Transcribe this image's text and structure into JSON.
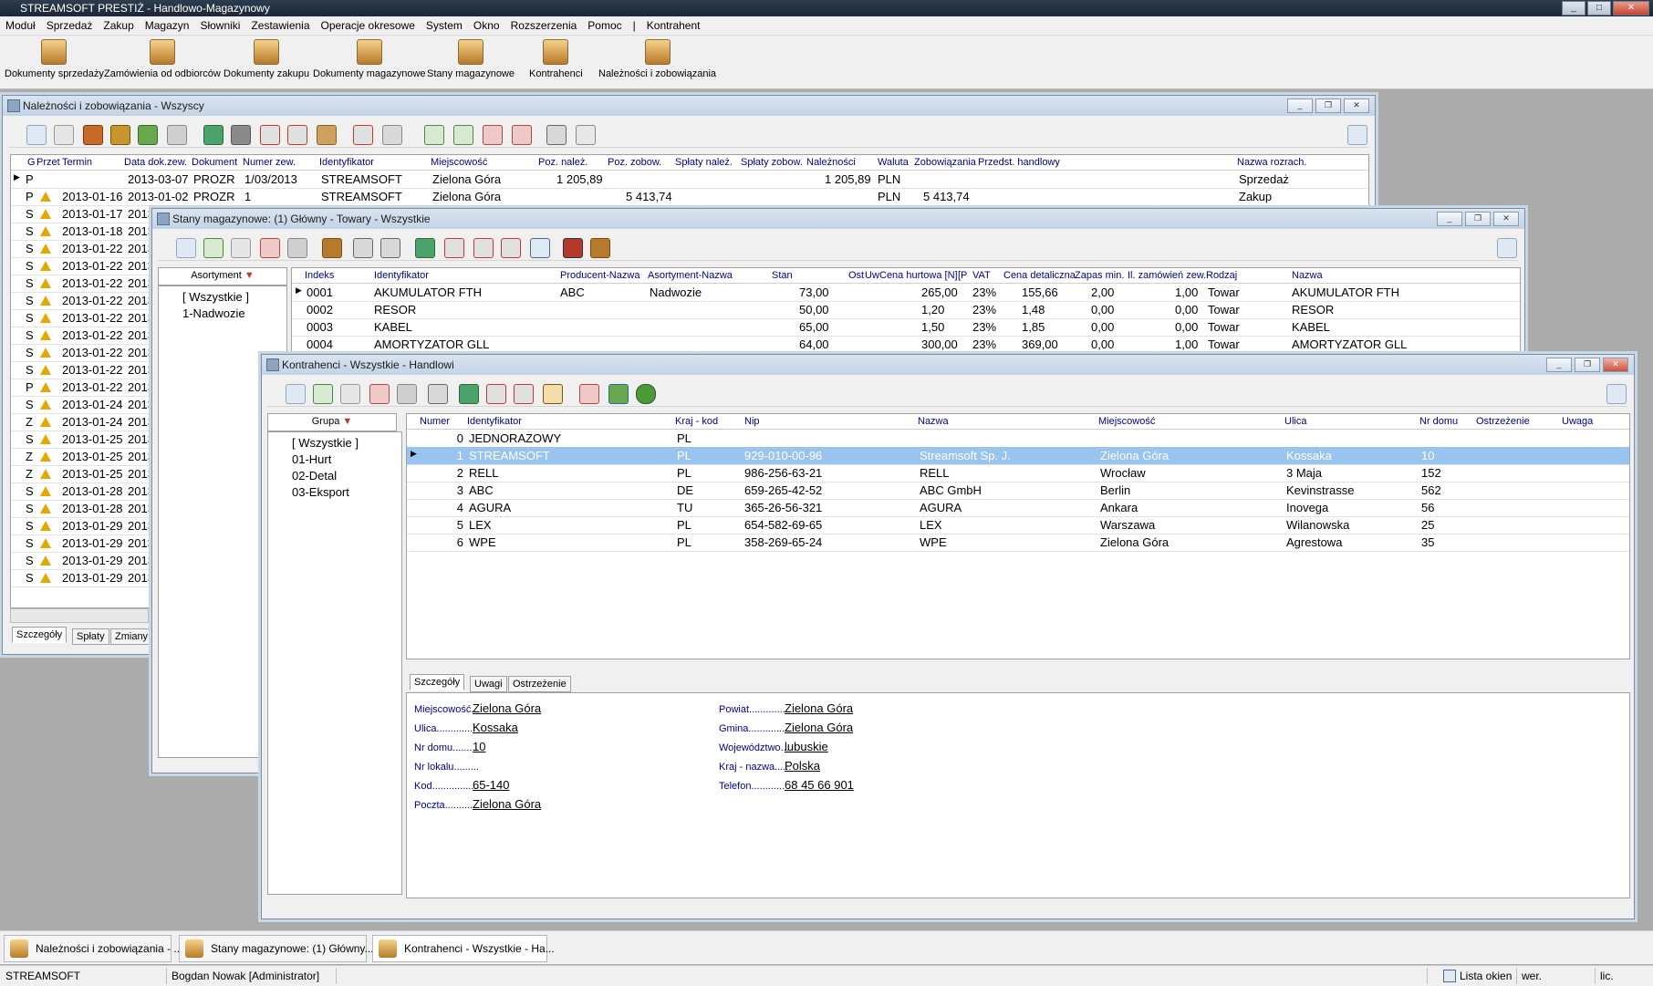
{
  "app": {
    "title": "STREAMSOFT PRESTIŻ - Handlowo-Magazynowy"
  },
  "menu": [
    "Moduł",
    "Sprzedaż",
    "Zakup",
    "Magazyn",
    "Słowniki",
    "Zestawienia",
    "Operacje okresowe",
    "System",
    "Okno",
    "Rozszerzenia",
    "Pomoc",
    "|",
    "Kontrahent"
  ],
  "big_toolbar": [
    "Dokumenty sprzedaży",
    "Zamówienia od odbiorców",
    "Dokumenty zakupu",
    "Dokumenty magazynowe",
    "Stany magazynowe",
    "Kontrahenci",
    "Należności i zobowiązania"
  ],
  "win1": {
    "title": "Należności i zobowiązania - Wszyscy",
    "columns": [
      "G",
      "Przet",
      "Termin",
      "Data dok.zew.",
      "Dokument",
      "Numer zew.",
      "Identyfikator",
      "Miejscowość",
      "Poz. należ.",
      "Poz. zobow.",
      "Spłaty należ.",
      "Spłaty zobow.",
      "Należności",
      "Waluta",
      "Zobowiązania",
      "Przedst. handlowy",
      "Nazwa rozrach."
    ],
    "rows": [
      {
        "g": "P",
        "termin": "",
        "data": "2013-03-07",
        "dok": "PROZR",
        "nr": "1/03/2013",
        "id": "STREAMSOFT",
        "miejsc": "Zielona Góra",
        "poznal": "1 205,89",
        "pozzob": "",
        "nal": "1 205,89",
        "waluta": "PLN",
        "zob": "",
        "nazwa": "Sprzedaż"
      },
      {
        "g": "P",
        "termin": "2013-01-16",
        "data": "2013-01-02",
        "dok": "PROZR",
        "nr": "1",
        "id": "STREAMSOFT",
        "miejsc": "Zielona Góra",
        "poznal": "",
        "pozzob": "5 413,74",
        "nal": "",
        "waluta": "PLN",
        "zob": "5 413,74",
        "nazwa": "Zakup"
      },
      {
        "g": "S",
        "termin": "2013-01-17",
        "data": "2013"
      },
      {
        "g": "S",
        "termin": "2013-01-18",
        "data": "2013"
      },
      {
        "g": "S",
        "termin": "2013-01-22",
        "data": "2013"
      },
      {
        "g": "S",
        "termin": "2013-01-22",
        "data": "2013"
      },
      {
        "g": "S",
        "termin": "2013-01-22",
        "data": "2013"
      },
      {
        "g": "S",
        "termin": "2013-01-22",
        "data": "2013"
      },
      {
        "g": "S",
        "termin": "2013-01-22",
        "data": "2013"
      },
      {
        "g": "S",
        "termin": "2013-01-22",
        "data": "2013"
      },
      {
        "g": "S",
        "termin": "2013-01-22",
        "data": "2013"
      },
      {
        "g": "S",
        "termin": "2013-01-22",
        "data": "2013"
      },
      {
        "g": "P",
        "termin": "2013-01-22",
        "data": "2013"
      },
      {
        "g": "S",
        "termin": "2013-01-24",
        "data": "2013"
      },
      {
        "g": "Z",
        "termin": "2013-01-24",
        "data": "2013"
      },
      {
        "g": "S",
        "termin": "2013-01-25",
        "data": "2013"
      },
      {
        "g": "Z",
        "termin": "2013-01-25",
        "data": "2013"
      },
      {
        "g": "Z",
        "termin": "2013-01-25",
        "data": "2013"
      },
      {
        "g": "S",
        "termin": "2013-01-28",
        "data": "2013"
      },
      {
        "g": "S",
        "termin": "2013-01-28",
        "data": "2013"
      },
      {
        "g": "S",
        "termin": "2013-01-29",
        "data": "2013"
      },
      {
        "g": "S",
        "termin": "2013-01-29",
        "data": "2013"
      },
      {
        "g": "S",
        "termin": "2013-01-29",
        "data": "2013"
      },
      {
        "g": "S",
        "termin": "2013-01-29",
        "data": "2013"
      }
    ],
    "tabs": [
      "Szczegóły",
      "Spłaty",
      "Zmiany"
    ]
  },
  "win2": {
    "title": "Stany magazynowe: (1) Główny - Towary - Wszystkie",
    "tree_header": "Asortyment",
    "tree": [
      "[ Wszystkie ]",
      "1-Nadwozie"
    ],
    "columns": [
      "Indeks",
      "Identyfikator",
      "Producent-Nazwa",
      "Asortyment-Nazwa",
      "Stan",
      "Ost",
      "Uw",
      "Cena hurtowa [N]",
      "[P",
      "VAT",
      "Cena detaliczna",
      "Zapas min.",
      "Il. zamówień zew.",
      "Rodzaj",
      "Nazwa"
    ],
    "rows": [
      {
        "idx": "0001",
        "id": "AKUMULATOR FTH",
        "prod": "ABC",
        "asort": "Nadwozie",
        "stan": "73,00",
        "hurt": "265,00",
        "vat": "23%",
        "det": "155,66",
        "zapas": "2,00",
        "zam": "1,00",
        "rodzaj": "Towar",
        "nazwa": "AKUMULATOR FTH"
      },
      {
        "idx": "0002",
        "id": "RESOR",
        "prod": "",
        "asort": "",
        "stan": "50,00",
        "hurt": "1,20",
        "vat": "23%",
        "det": "1,48",
        "zapas": "0,00",
        "zam": "0,00",
        "rodzaj": "Towar",
        "nazwa": "RESOR"
      },
      {
        "idx": "0003",
        "id": "KABEL",
        "prod": "",
        "asort": "",
        "stan": "65,00",
        "hurt": "1,50",
        "vat": "23%",
        "det": "1,85",
        "zapas": "0,00",
        "zam": "0,00",
        "rodzaj": "Towar",
        "nazwa": "KABEL"
      },
      {
        "idx": "0004",
        "id": "AMORTYZATOR GLL",
        "prod": "",
        "asort": "",
        "stan": "64,00",
        "hurt": "300,00",
        "vat": "23%",
        "det": "369,00",
        "zapas": "0,00",
        "zam": "1,00",
        "rodzaj": "Towar",
        "nazwa": "AMORTYZATOR GLL"
      }
    ]
  },
  "win3": {
    "title": "Kontrahenci - Wszystkie - Handlowi",
    "tree_header": "Grupa",
    "tree": [
      "[ Wszystkie ]",
      "01-Hurt",
      "02-Detal",
      "03-Eksport"
    ],
    "columns": [
      "Numer",
      "Identyfikator",
      "Kraj - kod",
      "Nip",
      "Nazwa",
      "Miejscowość",
      "Ulica",
      "Nr domu",
      "Ostrzeżenie",
      "Uwaga"
    ],
    "rows": [
      {
        "num": "0",
        "id": "JEDNORAZOWY",
        "kraj": "PL",
        "nip": "",
        "nazwa": "",
        "miejsc": "",
        "ulica": "",
        "nr": ""
      },
      {
        "num": "1",
        "id": "STREAMSOFT",
        "kraj": "PL",
        "nip": "929-010-00-96",
        "nazwa": "Streamsoft Sp. J.",
        "miejsc": "Zielona Góra",
        "ulica": "Kossaka",
        "nr": "10"
      },
      {
        "num": "2",
        "id": "RELL",
        "kraj": "PL",
        "nip": "986-256-63-21",
        "nazwa": "RELL",
        "miejsc": "Wrocław",
        "ulica": "3 Maja",
        "nr": "152"
      },
      {
        "num": "3",
        "id": "ABC",
        "kraj": "DE",
        "nip": "659-265-42-52",
        "nazwa": "ABC GmbH",
        "miejsc": "Berlin",
        "ulica": "Kevinstrasse",
        "nr": "562"
      },
      {
        "num": "4",
        "id": "AGURA",
        "kraj": "TU",
        "nip": "365-26-56-321",
        "nazwa": "AGURA",
        "miejsc": "Ankara",
        "ulica": "Inovega",
        "nr": "56"
      },
      {
        "num": "5",
        "id": "LEX",
        "kraj": "PL",
        "nip": "654-582-69-65",
        "nazwa": "LEX",
        "miejsc": "Warszawa",
        "ulica": "Wilanowska",
        "nr": "25"
      },
      {
        "num": "6",
        "id": "WPE",
        "kraj": "PL",
        "nip": "358-269-65-24",
        "nazwa": "WPE",
        "miejsc": "Zielona Góra",
        "ulica": "Agrestowa",
        "nr": "35"
      }
    ],
    "tabs": [
      "Szczegóły",
      "Uwagi",
      "Ostrzeżenie"
    ],
    "details_left": [
      {
        "label": "Miejscowość...",
        "value": "Zielona Góra"
      },
      {
        "label": "Ulica..............",
        "value": "Kossaka"
      },
      {
        "label": "Nr domu.........",
        "value": "10"
      },
      {
        "label": "Nr lokalu.........",
        "value": ""
      },
      {
        "label": "Kod................",
        "value": "65-140"
      },
      {
        "label": "Poczta............",
        "value": "Zielona Góra"
      }
    ],
    "details_right": [
      {
        "label": "Powiat...............",
        "value": "Zielona Góra"
      },
      {
        "label": "Gmina...............",
        "value": "Zielona Góra"
      },
      {
        "label": "Województwo...",
        "value": "lubuskie"
      },
      {
        "label": "Kraj - nazwa......",
        "value": "Polska"
      },
      {
        "label": "Telefon............",
        "value": "68 45 66 901"
      }
    ]
  },
  "taskbar": [
    "Należności i zobowiązania - ...",
    "Stany magazynowe: (1) Główny...",
    "Kontrahenci - Wszystkie - Ha..."
  ],
  "status": {
    "company": "STREAMSOFT",
    "user": "Bogdan Nowak [Administrator]",
    "windows": "Lista okien",
    "wer": "wer.",
    "lic": "lic."
  },
  "colors": {
    "selection": "#99c4f0",
    "header_text": "#00008b",
    "warning": "#e5a800"
  }
}
